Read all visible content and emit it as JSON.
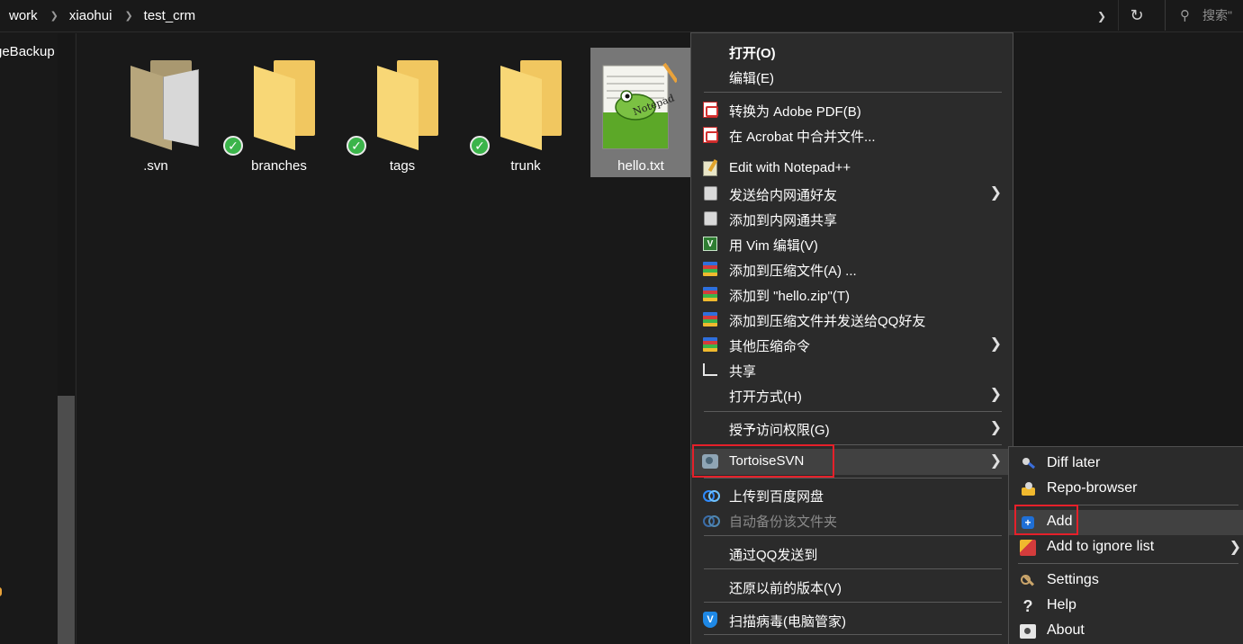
{
  "address_bar": {
    "breadcrumbs": [
      "work",
      "xiaohui",
      "test_crm"
    ],
    "search_placeholder": "搜索\""
  },
  "nav": {
    "visible_item": "geBackup"
  },
  "files": [
    {
      "name": ".svn",
      "type": "folder",
      "variant": "svn",
      "badge": false
    },
    {
      "name": "branches",
      "type": "folder",
      "badge": true
    },
    {
      "name": "tags",
      "type": "folder",
      "badge": true
    },
    {
      "name": "trunk",
      "type": "folder",
      "badge": true
    },
    {
      "name": "hello.txt",
      "type": "notepad-file",
      "selected": true
    }
  ],
  "context_menu": {
    "items": [
      {
        "label": "打开(O)",
        "bold": true
      },
      {
        "label": "编辑(E)"
      },
      {
        "label": "转换为 Adobe PDF(B)",
        "icon": "pdf-icon"
      },
      {
        "label": "在 Acrobat 中合并文件...",
        "icon": "pdf-icon"
      },
      {
        "label": "Edit with Notepad++",
        "icon": "notepad-icon"
      },
      {
        "label": "发送给内网通好友",
        "icon": "contact-icon",
        "submenu": true
      },
      {
        "label": "添加到内网通共享",
        "icon": "contact-icon"
      },
      {
        "label": "用 Vim 编辑(V)",
        "icon": "vim-icon"
      },
      {
        "label": "添加到压缩文件(A) ...",
        "icon": "winrar-icon"
      },
      {
        "label": "添加到 \"hello.zip\"(T)",
        "icon": "winrar-icon"
      },
      {
        "label": "添加到压缩文件并发送给QQ好友",
        "icon": "winrar-icon"
      },
      {
        "label": "其他压缩命令",
        "icon": "winrar-icon",
        "submenu": true
      },
      {
        "label": "共享",
        "icon": "share-icon"
      },
      {
        "label": "打开方式(H)",
        "submenu": true
      },
      {
        "label": "授予访问权限(G)",
        "submenu": true
      },
      {
        "label": "TortoiseSVN",
        "icon": "tortoisesvn-icon",
        "submenu": true,
        "highlighted": true
      },
      {
        "label": "上传到百度网盘",
        "icon": "baidu-cloud-icon"
      },
      {
        "label": "自动备份该文件夹",
        "icon": "baidu-cloud-icon",
        "disabled": true
      },
      {
        "label": "通过QQ发送到"
      },
      {
        "label": "还原以前的版本(V)"
      },
      {
        "label": "扫描病毒(电脑管家)",
        "icon": "shield-icon"
      }
    ]
  },
  "svn_submenu": {
    "items": [
      {
        "label": "Diff later",
        "icon": "diff-icon"
      },
      {
        "label": "Repo-browser",
        "icon": "repo-browser-icon"
      },
      {
        "label": "Add",
        "icon": "add-icon",
        "highlighted": true
      },
      {
        "label": "Add to ignore list",
        "icon": "ignore-icon",
        "submenu": true
      },
      {
        "label": "Settings",
        "icon": "settings-icon"
      },
      {
        "label": "Help",
        "icon": "help-icon"
      },
      {
        "label": "About",
        "icon": "about-icon"
      }
    ]
  },
  "colors": {
    "background": "#191919",
    "menu_bg": "#2b2b2b",
    "menu_hover": "#414141",
    "highlight_box": "#e5202a",
    "folder": "#f8d776",
    "svn_ok_badge": "#3bb44a"
  }
}
